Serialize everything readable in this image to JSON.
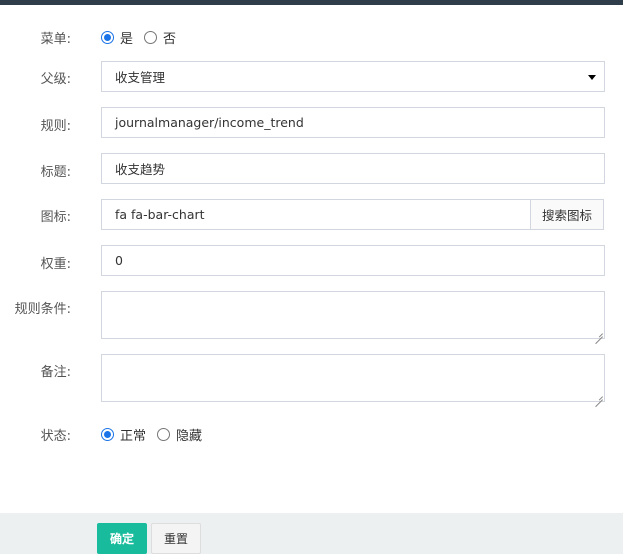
{
  "form": {
    "menu": {
      "label": "菜单:",
      "options": [
        "是",
        "否"
      ],
      "selected": 0
    },
    "parent": {
      "label": "父级:",
      "value": "收支管理"
    },
    "rule": {
      "label": "规则:",
      "value": "journalmanager/income_trend"
    },
    "title": {
      "label": "标题:",
      "value": "收支趋势"
    },
    "icon": {
      "label": "图标:",
      "value": "fa fa-bar-chart",
      "button": "搜索图标"
    },
    "weight": {
      "label": "权重:",
      "value": "0"
    },
    "condition": {
      "label": "规则条件:",
      "value": ""
    },
    "remark": {
      "label": "备注:",
      "value": ""
    },
    "status": {
      "label": "状态:",
      "options": [
        "正常",
        "隐藏"
      ],
      "selected": 0
    }
  },
  "footer": {
    "ok": "确定",
    "reset": "重置"
  },
  "colors": {
    "topbar": "#2f3d4a",
    "primary": "#18bc9c",
    "radio": "#1a73e8",
    "footer_bg": "#ecf0f1"
  }
}
